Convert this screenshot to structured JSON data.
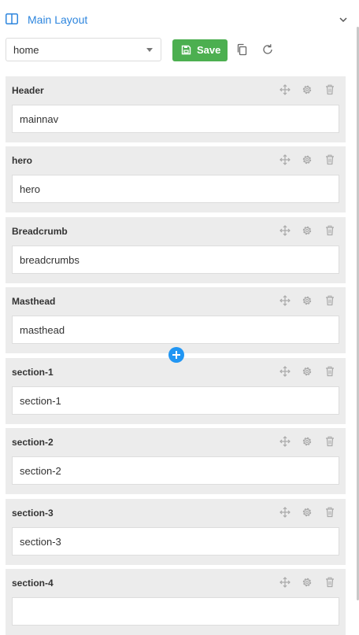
{
  "panel": {
    "title": "Main Layout"
  },
  "toolbar": {
    "layout_select": "home",
    "save_label": "Save"
  },
  "blocks": [
    {
      "title": "Header",
      "value": "mainnav"
    },
    {
      "title": "hero",
      "value": "hero"
    },
    {
      "title": "Breadcrumb",
      "value": "breadcrumbs"
    },
    {
      "title": "Masthead",
      "value": "masthead"
    },
    {
      "title": "section-1",
      "value": "section-1"
    },
    {
      "title": "section-2",
      "value": "section-2"
    },
    {
      "title": "section-3",
      "value": "section-3"
    },
    {
      "title": "section-4",
      "value": ""
    }
  ],
  "icons": {
    "layout": "layout-icon",
    "collapse": "chevron-down-icon",
    "save": "floppy-disk-icon",
    "copy": "copy-icon",
    "refresh": "refresh-icon",
    "move": "move-icon",
    "settings": "gear-icon",
    "delete": "trash-icon",
    "add": "plus-icon"
  },
  "colors": {
    "accent": "#2e86de",
    "save_button": "#4caf50",
    "add_button": "#2196f3",
    "block_background": "#ececec"
  }
}
